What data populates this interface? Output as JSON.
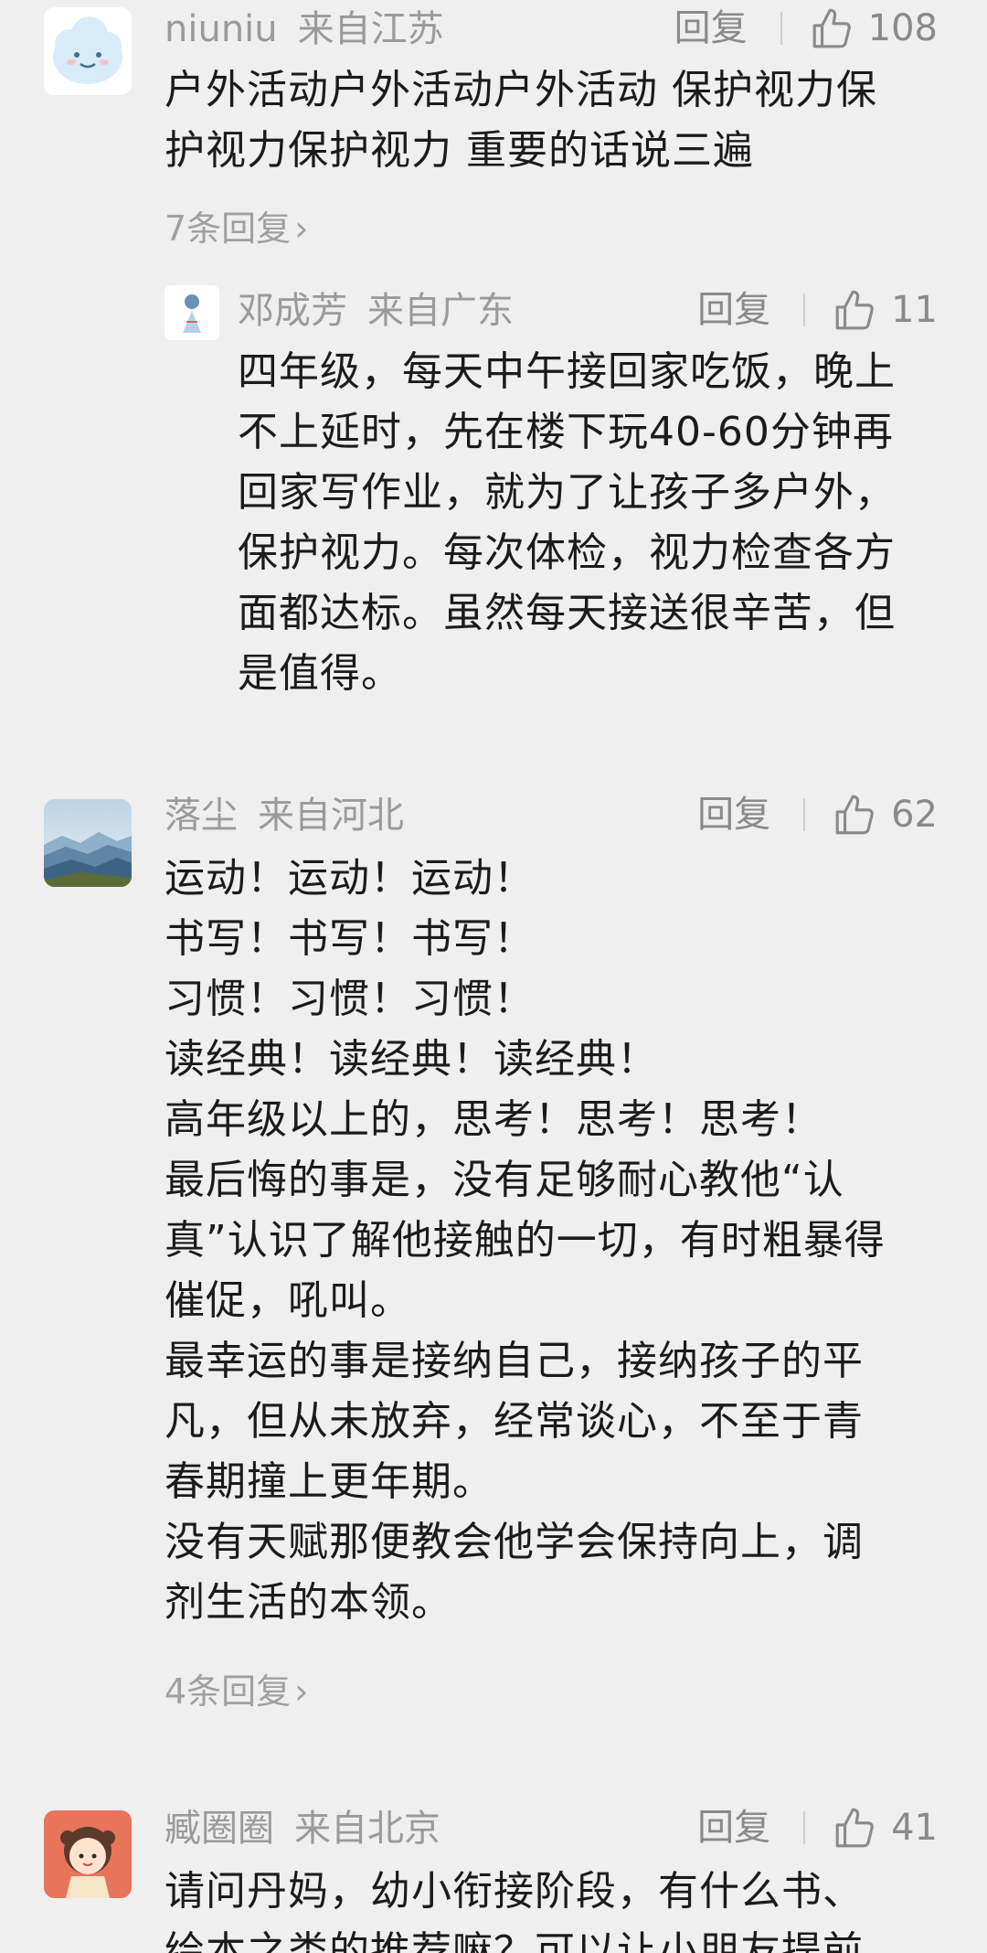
{
  "comments": [
    {
      "author": "niuniu",
      "location": "来自江苏",
      "reply_label": "回复",
      "likes": "108",
      "lines": [
        "户外活动户外活动户外活动 保护视力保",
        "护视力保护视力 重要的话说三遍"
      ],
      "replies_link": "7条回复",
      "avatar_icon": "cloud-face-icon"
    },
    {
      "author": "邓成芳",
      "location": "来自广东",
      "reply_label": "回复",
      "likes": "11",
      "lines": [
        "四年级，每天中午接回家吃饭，晚上",
        "不上延时，先在楼下玩40-60分钟再",
        "回家写作业，就为了让孩子多户外，",
        "保护视力。每次体检，视力检查各方",
        "面都达标。虽然每天接送很辛苦，但",
        "是值得。"
      ],
      "avatar_icon": "figure-avatar-icon"
    },
    {
      "author": "落尘",
      "location": "来自河北",
      "reply_label": "回复",
      "likes": "62",
      "lines": [
        "运动！运动！运动！",
        "书写！书写！书写！",
        "习惯！习惯！习惯！",
        "读经典！读经典！读经典！",
        "高年级以上的，思考！思考！思考！",
        "最后悔的事是，没有足够耐心教他“认",
        "真”认识了解他接触的一切，有时粗暴得",
        "催促，吼叫。",
        "最幸运的事是接纳自己，接纳孩子的平",
        "凡，但从未放弃，经常谈心，不至于青",
        "春期撞上更年期。",
        "没有天赋那便教会他学会保持向上，调",
        "剂生活的本领。"
      ],
      "replies_link": "4条回复",
      "avatar_icon": "mountain-landscape-icon"
    },
    {
      "author": "臧圈圈",
      "location": "来自北京",
      "reply_label": "回复",
      "likes": "41",
      "lines": [
        "请问丹妈，幼小衔接阶段，有什么书、",
        "绘本之类的推荐嘛？可以让小朋友提前"
      ],
      "avatar_icon": "cartoon-girl-icon"
    }
  ],
  "colors": {
    "background": "#efefef",
    "text": "#1b1b1b",
    "meta": "#9a9a9a"
  }
}
